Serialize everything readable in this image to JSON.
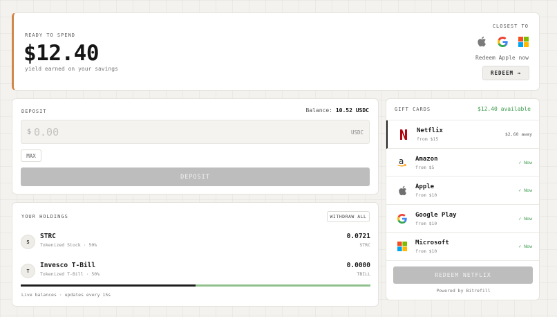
{
  "hero": {
    "eyebrow": "READY TO SPEND",
    "amount": "$12.40",
    "subtitle": "yield earned on your savings",
    "closest_label": "CLOSEST TO",
    "brands": [
      "apple-icon",
      "google-icon",
      "microsoft-icon"
    ],
    "redeem_hint": "Redeem Apple now",
    "redeem_button": "REDEEM →",
    "accent_color": "#d2874a"
  },
  "deposit": {
    "label": "DEPOSIT",
    "balance_label": "Balance:",
    "balance_value": "10.52 USDC",
    "currency_symbol": "$",
    "amount_placeholder": "0.00",
    "unit": "USDC",
    "max_button": "MAX",
    "deposit_button": "DEPOSIT"
  },
  "holdings": {
    "label": "YOUR HOLDINGS",
    "withdraw_button": "WITHDRAW ALL",
    "items": [
      {
        "avatar": "S",
        "name": "STRC",
        "meta": "Tokenized Stock · 50%",
        "value": "0.0721",
        "ticker": "STRC"
      },
      {
        "avatar": "T",
        "name": "Invesco T-Bill",
        "meta": "Tokenized T-Bill · 50%",
        "value": "0.0000",
        "ticker": "TBILL"
      }
    ],
    "allocation": [
      {
        "fraction": 0.5,
        "color": "#1e1e1e"
      },
      {
        "fraction": 0.5,
        "color": "#8fc08b"
      }
    ],
    "footer": "Live balances · updates every 15s"
  },
  "gift_cards": {
    "label": "GIFT CARDS",
    "available": "$12.40 available",
    "items": [
      {
        "icon": "netflix-icon",
        "name": "Netflix",
        "from": "from $15",
        "status": "$2.60 away",
        "ready": false,
        "selected": true
      },
      {
        "icon": "amazon-icon",
        "name": "Amazon",
        "from": "from $5",
        "status": "✓ Now",
        "ready": true,
        "selected": false
      },
      {
        "icon": "apple-icon",
        "name": "Apple",
        "from": "from $10",
        "status": "✓ Now",
        "ready": true,
        "selected": false
      },
      {
        "icon": "google-icon",
        "name": "Google Play",
        "from": "from $10",
        "status": "✓ Now",
        "ready": true,
        "selected": false
      },
      {
        "icon": "microsoft-icon",
        "name": "Microsoft",
        "from": "from $10",
        "status": "✓ Now",
        "ready": true,
        "selected": false
      }
    ],
    "redeem_button": "REDEEM NETFLIX",
    "powered_by": "Powered by Bitrefill",
    "available_color": "#3a9a4a"
  }
}
